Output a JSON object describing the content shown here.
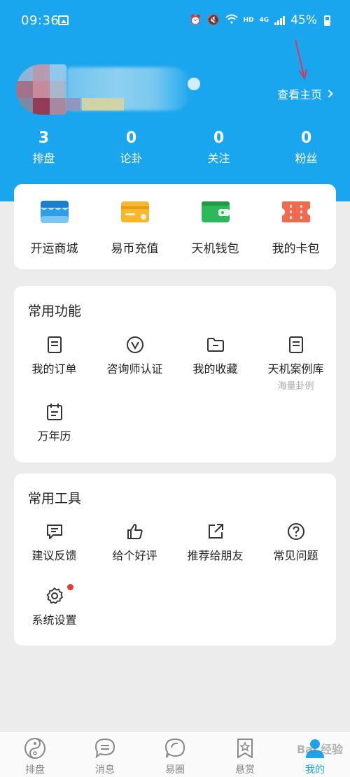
{
  "status_bar": {
    "time": "09:36",
    "network_label": "HD",
    "network_gen": "4G",
    "battery": "45%"
  },
  "profile": {
    "home_link": "查看主页",
    "stats": [
      {
        "value": "3",
        "label": "排盘"
      },
      {
        "value": "0",
        "label": "论卦"
      },
      {
        "value": "0",
        "label": "关注"
      },
      {
        "value": "0",
        "label": "粉丝"
      }
    ]
  },
  "wallet": {
    "items": [
      {
        "label": "开运商城",
        "icon": "shop-icon",
        "color": "#2f9ee8"
      },
      {
        "label": "易币充值",
        "icon": "recharge-card-icon",
        "color": "#f5b82e"
      },
      {
        "label": "天机钱包",
        "icon": "wallet-icon",
        "color": "#2eb85c"
      },
      {
        "label": "我的卡包",
        "icon": "ticket-icon",
        "color": "#ef6a4f"
      }
    ]
  },
  "functions": {
    "title": "常用功能",
    "items": [
      {
        "label": "我的订单",
        "icon": "order-icon"
      },
      {
        "label": "咨询师认证",
        "icon": "certify-icon"
      },
      {
        "label": "我的收藏",
        "icon": "folder-icon"
      },
      {
        "label": "天机案例库",
        "icon": "case-library-icon",
        "sub": "海量卦例"
      },
      {
        "label": "万年历",
        "icon": "calendar-icon"
      }
    ]
  },
  "tools": {
    "title": "常用工具",
    "items": [
      {
        "label": "建议反馈",
        "icon": "feedback-icon"
      },
      {
        "label": "给个好评",
        "icon": "thumbs-up-icon"
      },
      {
        "label": "推荐给朋友",
        "icon": "share-icon"
      },
      {
        "label": "常见问题",
        "icon": "help-icon"
      },
      {
        "label": "系统设置",
        "icon": "gear-icon"
      }
    ]
  },
  "bottom_nav": {
    "items": [
      {
        "label": "排盘",
        "icon": "yin-yang-icon"
      },
      {
        "label": "消息",
        "icon": "message-icon"
      },
      {
        "label": "易圈",
        "icon": "circle-icon"
      },
      {
        "label": "悬赏",
        "icon": "star-badge-icon"
      },
      {
        "label": "我的",
        "icon": "user-icon",
        "active": true
      }
    ],
    "watermark": "Bai 经验"
  },
  "colors": {
    "header_blue": "#1aa6ee",
    "accent_red": "#e53935"
  }
}
